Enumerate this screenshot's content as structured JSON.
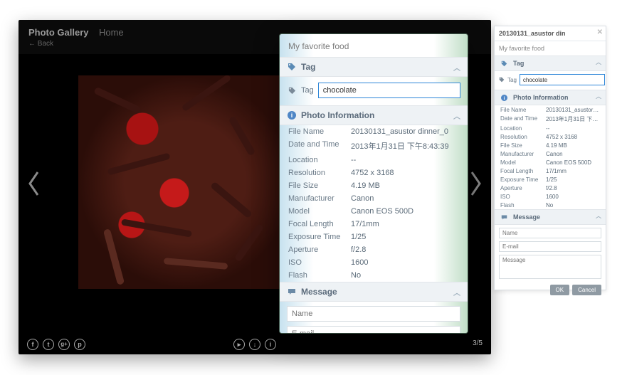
{
  "viewer": {
    "app_title": "Photo Gallery",
    "home_label": "Home",
    "back_label": "← Back",
    "counter": "3/5"
  },
  "panel": {
    "title": "My favorite food",
    "tag_section": "Tag",
    "tag_label": "Tag",
    "tag_value": "chocolate",
    "info_section": "Photo Information",
    "msg_section": "Message",
    "name_placeholder": "Name",
    "email_placeholder": "E-mail",
    "msg_placeholder": "Message",
    "info": [
      {
        "k": "File Name",
        "v": "20130131_asustor dinner_0"
      },
      {
        "k": "Date and Time",
        "v": "2013年1月31日 下午8:43:39"
      },
      {
        "k": "Location",
        "v": "--"
      },
      {
        "k": "Resolution",
        "v": "4752 x 3168"
      },
      {
        "k": "File Size",
        "v": "4.19 MB"
      },
      {
        "k": "Manufacturer",
        "v": "Canon"
      },
      {
        "k": "Model",
        "v": "Canon EOS 500D"
      },
      {
        "k": "Focal Length",
        "v": "17/1mm"
      },
      {
        "k": "Exposure Time",
        "v": "1/25"
      },
      {
        "k": "Aperture",
        "v": "f/2.8"
      },
      {
        "k": "ISO",
        "v": "1600"
      },
      {
        "k": "Flash",
        "v": "No"
      }
    ]
  },
  "side": {
    "window_title": "20130131_asustor din",
    "subtitle": "My favorite food",
    "ok_label": "OK",
    "cancel_label": "Cancel"
  },
  "icons": {
    "tag": "tag-icon",
    "info": "info-icon",
    "msg": "speech-bubble-icon"
  },
  "colors": {
    "header_bg": "#eef2f5",
    "accent_border": "#2e86d8"
  }
}
